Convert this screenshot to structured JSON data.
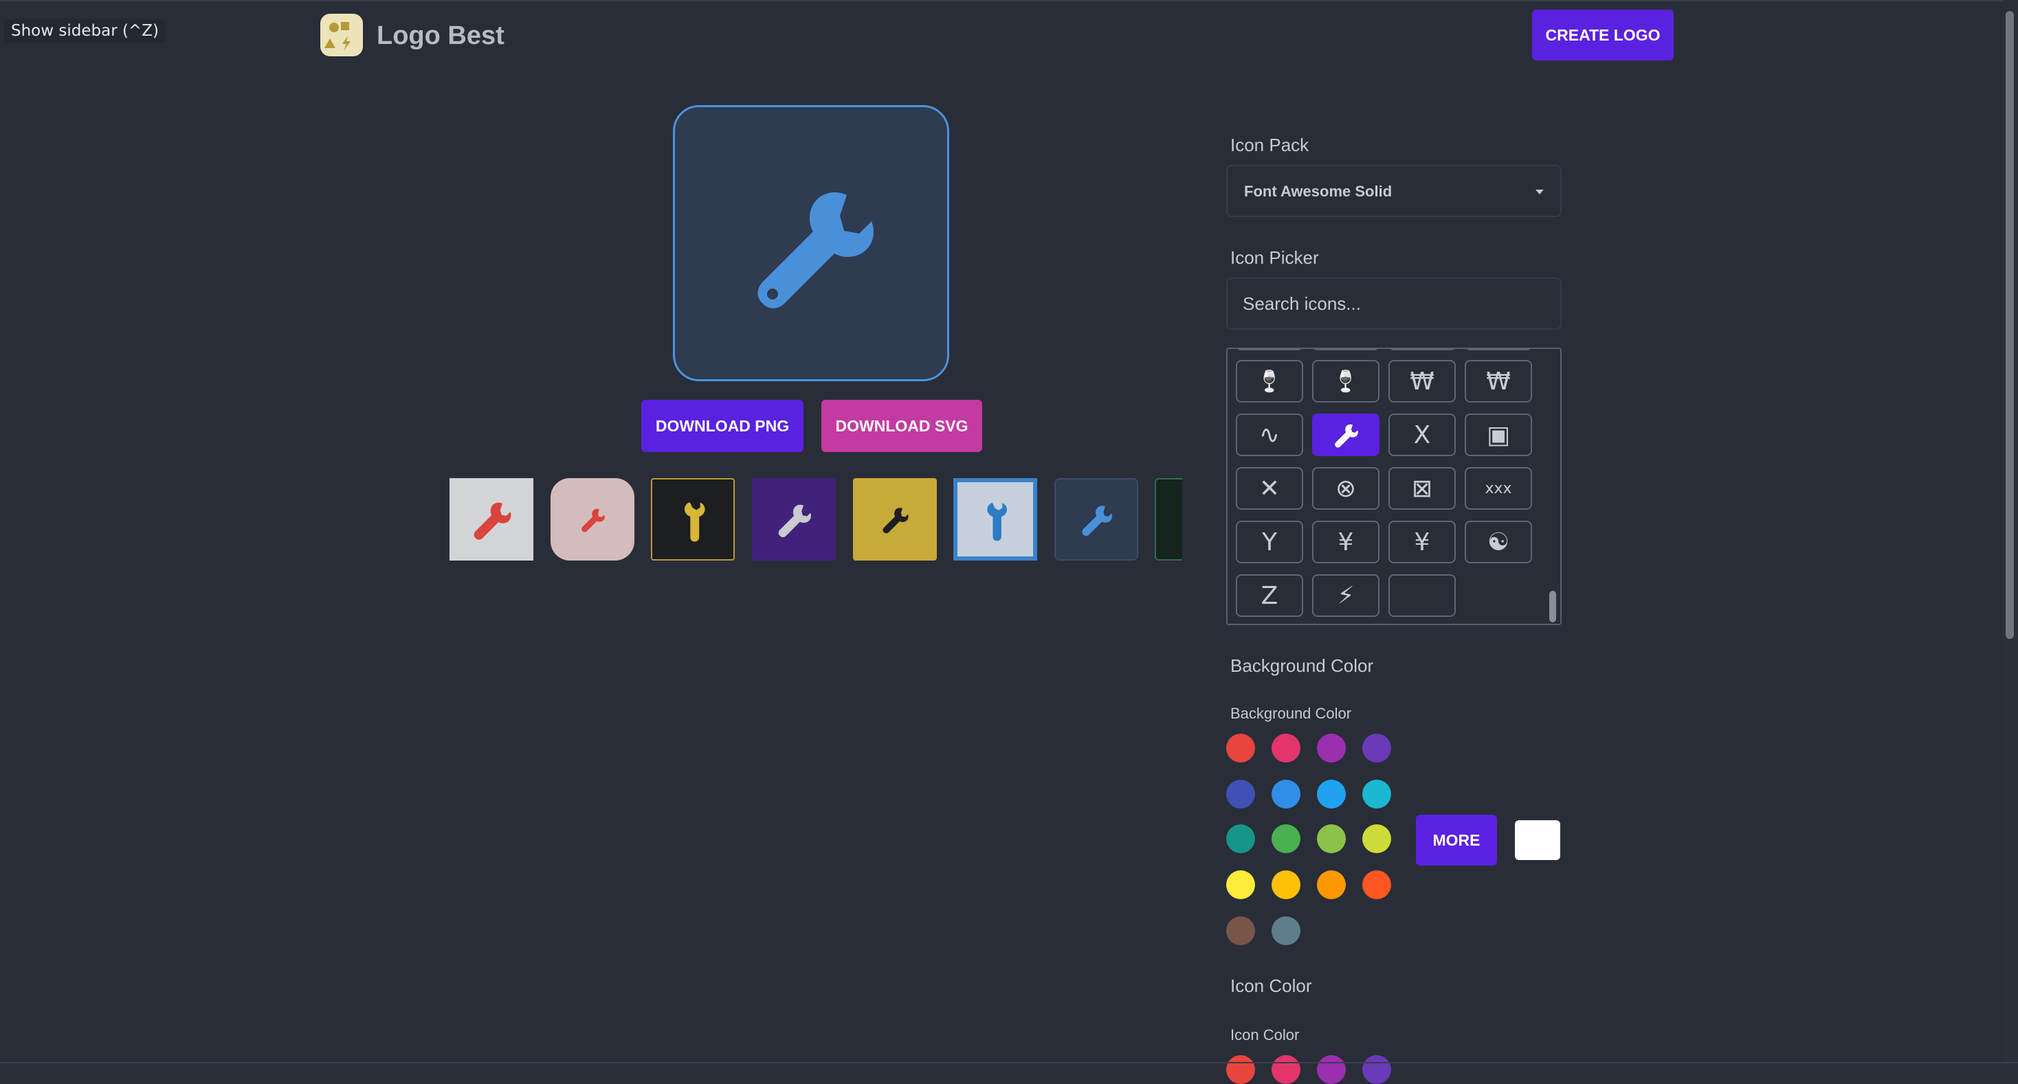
{
  "sidebar_toggle": {
    "label": "Show sidebar (^Z)"
  },
  "header": {
    "title": "Logo Best",
    "create_label": "CREATE LOGO",
    "logo_icon": "logo-mark-icon"
  },
  "preview": {
    "icon": "wrench-icon",
    "icon_color": "#4a90d9",
    "background": "#2e3b50",
    "border": "#4d92df"
  },
  "actions": {
    "download_png": "DOWNLOAD PNG",
    "download_svg": "DOWNLOAD SVG"
  },
  "presets": [
    {
      "bg": "#d3d4d8",
      "fg": "#d9443c",
      "border": "none"
    },
    {
      "bg": "#d5bcbc",
      "fg": "#d9443c",
      "border": "none"
    },
    {
      "bg": "#1d1e21",
      "fg": "#d7b63a",
      "border": "#b69a36"
    },
    {
      "bg": "#40227a",
      "fg": "#c9cbd1",
      "border": "none"
    },
    {
      "bg": "#c7aa38",
      "fg": "#1d1e21",
      "border": "none"
    },
    {
      "bg": "#c6d1dd",
      "fg": "#2f7bc4",
      "border": "#3b82c8"
    },
    {
      "bg": "#2e3b50",
      "fg": "#4a90d9",
      "border": "#3a4c66"
    },
    {
      "bg": "#15241d",
      "fg": "#2f7b4f",
      "border": "#2f6e4a"
    }
  ],
  "icon_pack": {
    "label": "Icon Pack",
    "value": "Font Awesome Solid"
  },
  "icon_picker": {
    "label": "Icon Picker",
    "placeholder": "Search icons...",
    "rows": [
      [
        {
          "icon": "wine-glass-icon",
          "glyph": "🍷"
        },
        {
          "icon": "wine-glass-alt-icon",
          "glyph": "🍷"
        },
        {
          "icon": "won-sign-icon",
          "glyph": "₩"
        },
        {
          "icon": "won-sign-alt-icon",
          "glyph": "₩"
        }
      ],
      [
        {
          "icon": "worm-icon",
          "glyph": "∿"
        },
        {
          "icon": "wrench-icon",
          "glyph": "",
          "selected": true
        },
        {
          "icon": "x-icon",
          "glyph": "X"
        },
        {
          "icon": "x-ray-icon",
          "glyph": "▣"
        }
      ],
      [
        {
          "icon": "xmark-icon",
          "glyph": "✕"
        },
        {
          "icon": "circle-xmark-icon",
          "glyph": "⊗"
        },
        {
          "icon": "square-xmark-icon",
          "glyph": "⊠"
        },
        {
          "icon": "xmarks-lines-icon",
          "glyph": "ⅹⅹⅹ"
        }
      ],
      [
        {
          "icon": "y-icon",
          "glyph": "Y"
        },
        {
          "icon": "yen-sign-icon",
          "glyph": "¥"
        },
        {
          "icon": "yen-sign-alt-icon",
          "glyph": "¥"
        },
        {
          "icon": "yin-yang-icon",
          "glyph": "☯"
        }
      ],
      [
        {
          "icon": "z-icon",
          "glyph": "Z"
        },
        {
          "icon": "bolt-icon",
          "glyph": "⚡"
        },
        {
          "icon": "empty-icon",
          "glyph": ""
        }
      ]
    ]
  },
  "background_color": {
    "section_label": "Background Color",
    "sub_label": "Background Color",
    "swatches": [
      "#e8453c",
      "#e2356b",
      "#9c2fb0",
      "#6a3ab8",
      "#3f51b5",
      "#2f8ee8",
      "#1fa3f0",
      "#1bb8d0",
      "#159688",
      "#4caf50",
      "#8bc34a",
      "#cddc39",
      "#ffeb3b",
      "#ffc107",
      "#ff9800",
      "#ff5722",
      "#795548",
      "#607d8b"
    ],
    "more_label": "MORE",
    "current": "#ffffff"
  },
  "icon_color": {
    "section_label": "Icon Color",
    "sub_label": "Icon Color",
    "swatches": [
      "#e8453c",
      "#e2356b",
      "#9c2fb0",
      "#6a3ab8"
    ]
  }
}
